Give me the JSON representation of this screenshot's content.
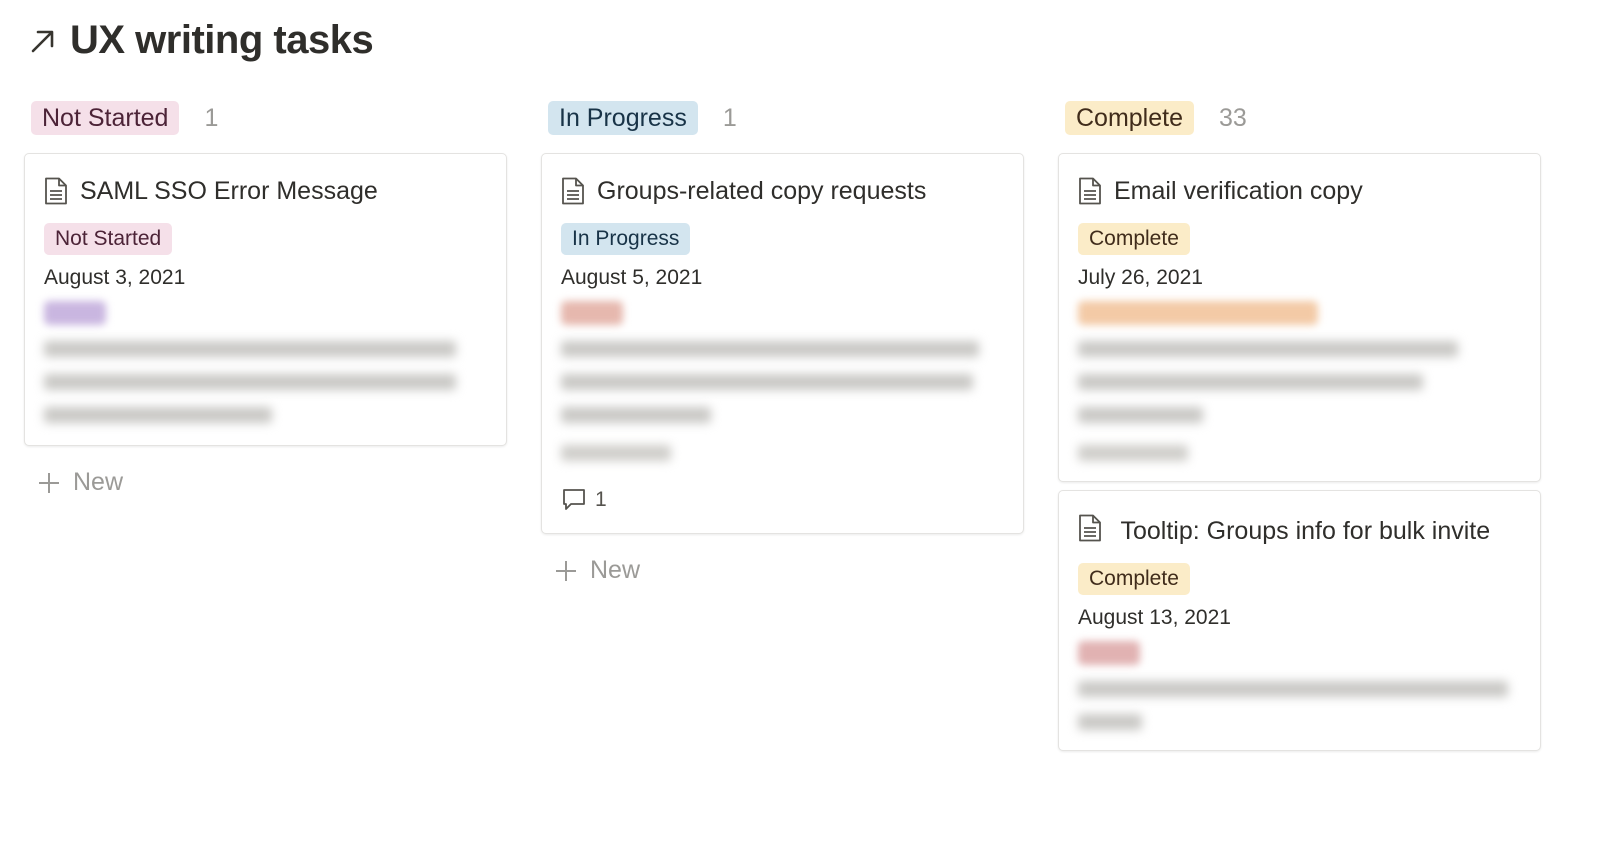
{
  "page": {
    "title": "UX writing tasks",
    "title_icon": "arrow-up-right-icon"
  },
  "colors": {
    "not_started_bg": "#f5e0e9",
    "not_started_fg": "#4c2337",
    "in_progress_bg": "#d3e5ef",
    "in_progress_fg": "#183347",
    "complete_bg": "#fbecc8",
    "complete_fg": "#402c1b",
    "blur_purple": "#c9b6e0",
    "blur_red": "#e6b8ae",
    "blur_orange": "#f3caa6",
    "blur_rose": "#e1b2b2"
  },
  "columns": [
    {
      "label": "Not Started",
      "count": "1",
      "new_label": "New",
      "cards": [
        {
          "title": "SAML SSO Error Message",
          "status": "Not Started",
          "date": "August 3, 2021",
          "redacted": true
        }
      ]
    },
    {
      "label": "In Progress",
      "count": "1",
      "new_label": "New",
      "cards": [
        {
          "title": "Groups-related copy requests",
          "status": "In Progress",
          "date": "August 5, 2021",
          "redacted": true,
          "comment_count": "1"
        }
      ]
    },
    {
      "label": "Complete",
      "count": "33",
      "cards": [
        {
          "title": "Email verification copy",
          "status": "Complete",
          "date": "July 26, 2021",
          "redacted": true
        },
        {
          "title": "Tooltip: Groups info for bulk invite",
          "status": "Complete",
          "date": "August 13, 2021",
          "redacted": true
        }
      ]
    }
  ]
}
